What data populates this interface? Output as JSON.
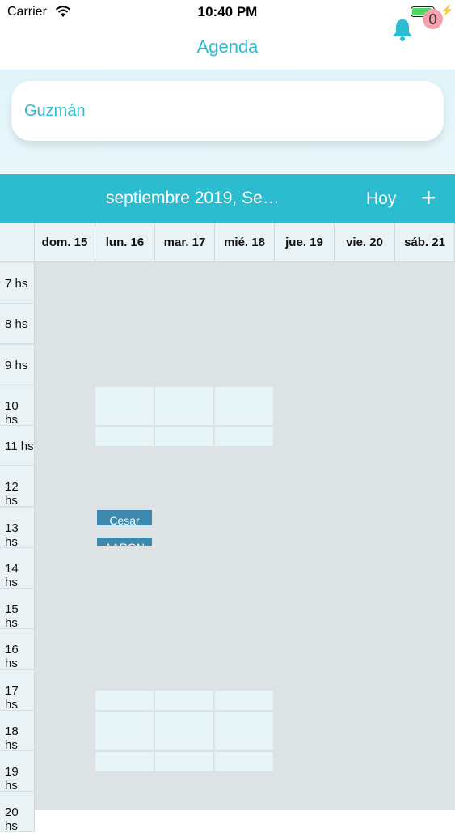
{
  "status_bar": {
    "carrier": "Carrier",
    "time": "10:40 PM"
  },
  "nav": {
    "title": "Agenda",
    "notification_count": "0"
  },
  "search": {
    "value": "Guzmán"
  },
  "calendar": {
    "month_label": "septiembre 2019, Se…",
    "today_label": "Hoy",
    "add_label": "+",
    "days": [
      "dom. 15",
      "lun. 16",
      "mar. 17",
      "mié. 18",
      "jue. 19",
      "vie. 20",
      "sáb. 21"
    ],
    "hours": [
      "7 hs",
      "8 hs",
      "9 hs",
      "10 hs",
      "11 hs",
      "12 hs",
      "13 hs",
      "14 hs",
      "15 hs",
      "16 hs",
      "17 hs",
      "18 hs",
      "19 hs",
      "20 hs"
    ],
    "appointments": [
      {
        "name": "Cesar",
        "day": "lun. 16",
        "start": "13:00"
      },
      {
        "name": "AARON",
        "day": "lun. 16",
        "start": "13:20"
      }
    ]
  }
}
